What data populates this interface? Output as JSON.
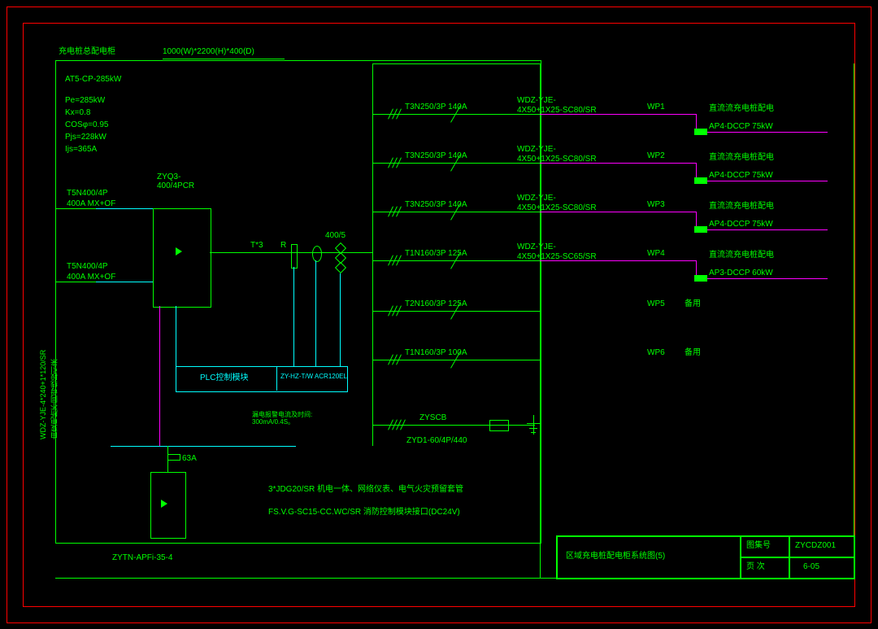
{
  "frame": {
    "cabinet_title": "充电桩总配电柜",
    "cabinet_dims": "1000(W)*2200(H)*400(D)",
    "rating": "AT5-CP-285kW",
    "params": {
      "pe": "Pe=285kW",
      "kx": "Kx=0.8",
      "cosphi": "COSφ=0.95",
      "pjs": "Pjs=228kW",
      "ijs": "Ijs=365A"
    },
    "incomer": {
      "top": "T5N400/4P",
      "top2": "400A MX+OF",
      "bot": "T5N400/4P",
      "bot2": "400A MX+OF",
      "ats": "ZYQ3-\n400/4PCR",
      "t3": "T*3",
      "r": "R",
      "ct": "400/5"
    },
    "plc": {
      "label": "PLC控制模块",
      "model": "ZY-HZ-T/W ACR120EL",
      "note": "漏电报警电流及时间:\n300mA/0.4S。"
    },
    "apf": {
      "fuse": "63A",
      "model": "ZYTN-APFi-35-4"
    },
    "notes": {
      "n1": "3*JDG20/SR    机电一体、网络仪表、电气火灾预留套管",
      "n2": "FS.V.G-SC15-CC.WC/SR    消防控制模块接口(DC24V)"
    },
    "spd": {
      "top": "ZYSCB",
      "bot": "ZYD1-60/4P/440"
    },
    "left_feed": {
      "cable": "WDZ-YJE-4*240+1*120/SR",
      "source": "由变电所不同母线段引来"
    },
    "feeders": [
      {
        "brk": "T3N250/3P 140A",
        "cable1": "WDZ-YJE-",
        "cable2": "4X50+1X25-SC80/SR",
        "wp": "WP1",
        "dest1": "直流流充电桩配电",
        "dest2": "AP4-DCCP 75kW",
        "active": true
      },
      {
        "brk": "T3N250/3P 140A",
        "cable1": "WDZ-YJE-",
        "cable2": "4X50+1X25-SC80/SR",
        "wp": "WP2",
        "dest1": "直流流充电桩配电",
        "dest2": "AP4-DCCP 75kW",
        "active": true
      },
      {
        "brk": "T3N250/3P 140A",
        "cable1": "WDZ-YJE-",
        "cable2": "4X50+1X25-SC80/SR",
        "wp": "WP3",
        "dest1": "直流流充电桩配电",
        "dest2": "AP4-DCCP 75kW",
        "active": true
      },
      {
        "brk": "T1N160/3P 125A",
        "cable1": "WDZ-YJE-",
        "cable2": "4X50+1X25-SC65/SR",
        "wp": "WP4",
        "dest1": "直流流充电桩配电",
        "dest2": "AP3-DCCP 60kW",
        "active": true
      },
      {
        "brk": "T2N160/3P 125A",
        "cable1": "",
        "cable2": "",
        "wp": "WP5",
        "dest1": "备用",
        "dest2": "",
        "active": false
      },
      {
        "brk": "T1N160/3P 100A",
        "cable1": "",
        "cable2": "",
        "wp": "WP6",
        "dest1": "备用",
        "dest2": "",
        "active": false
      }
    ],
    "titleblock": {
      "drawing_title": "区域充电桩配电柜系统图(5)",
      "lbl_no": "图集号",
      "no": "ZYCDZ001",
      "lbl_page": "页 次",
      "page": "6-05"
    }
  }
}
